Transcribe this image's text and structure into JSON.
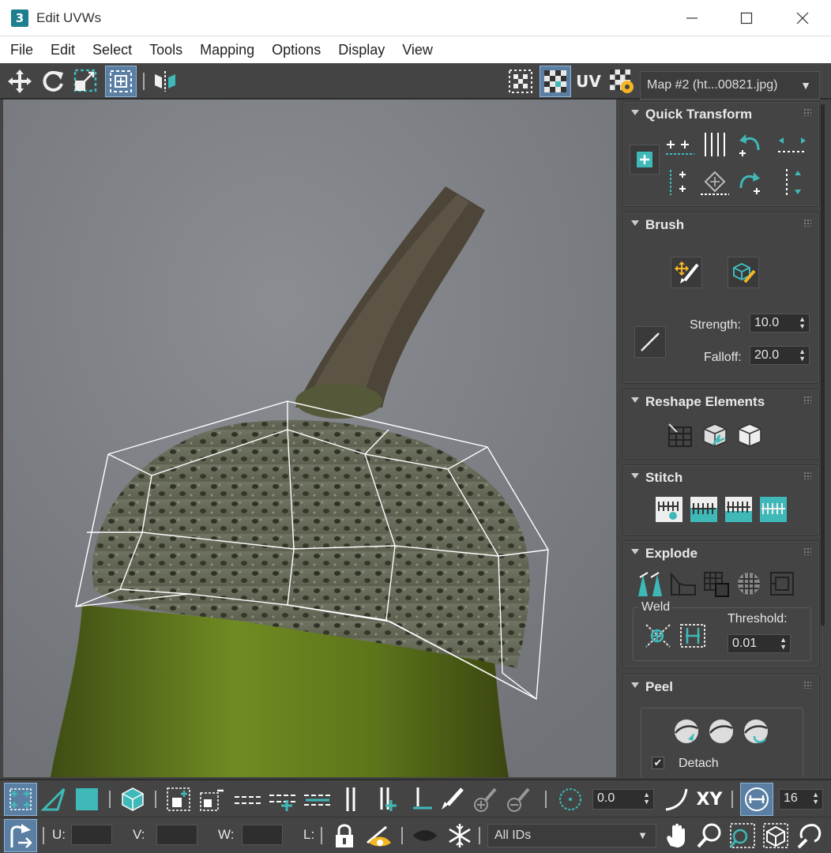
{
  "window": {
    "app_icon_label": "3",
    "title": "Edit UVWs"
  },
  "menu": [
    "File",
    "Edit",
    "Select",
    "Tools",
    "Mapping",
    "Options",
    "Display",
    "View"
  ],
  "top_toolbar": {
    "uv_label": "UV",
    "map_select": "Map #2 (ht...00821.jpg)"
  },
  "panels": {
    "quick_transform": {
      "title": "Quick Transform"
    },
    "brush": {
      "title": "Brush",
      "strength_label": "Strength:",
      "strength_value": "10.0",
      "falloff_label": "Falloff:",
      "falloff_value": "20.0"
    },
    "reshape": {
      "title": "Reshape Elements"
    },
    "stitch": {
      "title": "Stitch"
    },
    "explode": {
      "title": "Explode",
      "weld_label": "Weld",
      "threshold_label": "Threshold:",
      "threshold_value": "0.01"
    },
    "peel": {
      "title": "Peel",
      "detach_label": "Detach",
      "detach_checked": true
    }
  },
  "bottom_toolbar": {
    "rotation_value": "0.0",
    "xy_label": "XY",
    "grid_value": "16",
    "u_label": "U:",
    "v_label": "V:",
    "w_label": "W:",
    "l_label": "L:",
    "ids_select": "All IDs"
  },
  "colors": {
    "accent": "#3fb8b8",
    "active_button": "#5a7fa3",
    "panel_bg": "#444444",
    "wireframe": "#ffffff"
  }
}
